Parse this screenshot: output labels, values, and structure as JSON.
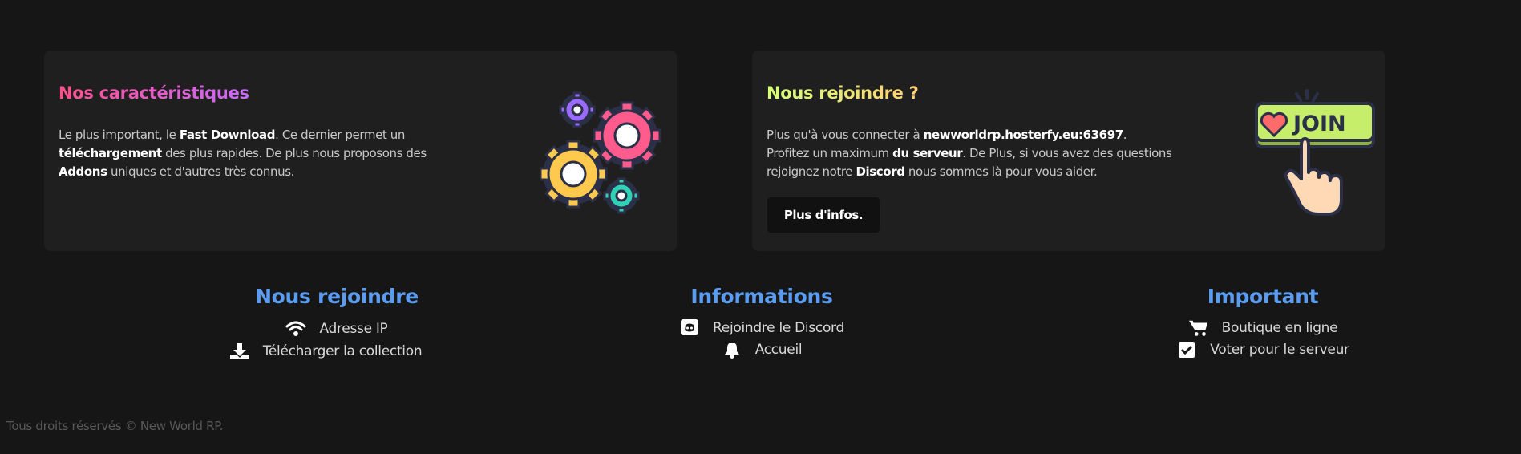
{
  "features_card": {
    "title": "Nos caractéristiques",
    "text_1": "Le plus important, le ",
    "bold_1": "Fast Download",
    "text_2": ". Ce dernier permet un ",
    "bold_2": "téléchargement",
    "text_3": " des plus rapides. De plus nous proposons des ",
    "bold_3": "Addons",
    "text_4": " uniques et d'autres très connus.",
    "illustration_icon": "gears-icon",
    "colors": [
      "#9b6bff",
      "#ff5c8d",
      "#ffc94d",
      "#2fd2b4",
      "#2b2f48"
    ]
  },
  "join_card": {
    "title": "Nous rejoindre ?",
    "text_1": "Plus qu'à vous connecter à ",
    "bold_1": "newworldrp.hosterfy.eu:63697",
    "text_2": ".",
    "text_3": "Profitez un maximum ",
    "bold_2": "du serveur",
    "text_4": ". De Plus, si vous avez des questions rejoignez notre ",
    "bold_3": "Discord",
    "text_5": " nous sommes là pour vous aider.",
    "button_label": "Plus d'infos.",
    "illustration_label": "JOIN",
    "illustration_icon": "join-button-icon"
  },
  "footer": {
    "columns": [
      {
        "title": "Nous rejoindre",
        "links": [
          {
            "label": "Adresse IP",
            "icon": "wifi-icon"
          },
          {
            "label": "Télécharger la collection",
            "icon": "download-icon"
          }
        ]
      },
      {
        "title": "Informations",
        "links": [
          {
            "label": "Rejoindre le Discord",
            "icon": "discord-icon"
          },
          {
            "label": "Accueil",
            "icon": "bell-icon"
          }
        ]
      },
      {
        "title": "Important",
        "links": [
          {
            "label": "Boutique en ligne",
            "icon": "cart-icon"
          },
          {
            "label": "Voter pour le serveur",
            "icon": "checkbox-icon"
          }
        ]
      }
    ],
    "copyright": "Tous droits réservés © New World RP."
  },
  "colors": {
    "background": "#161616",
    "card": "#1f1f1f",
    "footer_heading": "#5b9cf0",
    "pink_gradient": [
      "#ff4f8b",
      "#c86bff"
    ],
    "yellow_gradient": [
      "#d4ff7a",
      "#ffcf73"
    ]
  }
}
